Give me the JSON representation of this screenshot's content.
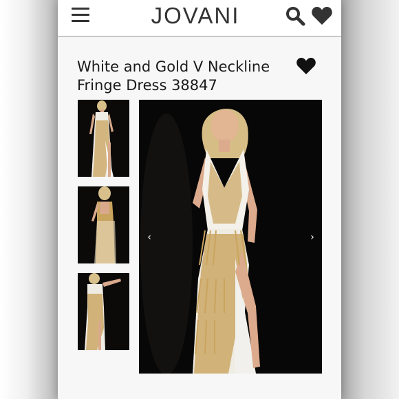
{
  "header": {
    "logo": "JOVANI",
    "icons": [
      "menu-icon",
      "search-icon",
      "heart-icon"
    ]
  },
  "product": {
    "title_line1": "White and Gold V Neckline",
    "title_line2": "Fringe Dress 38847"
  },
  "gallery": {
    "thumbnail_count": 3,
    "prev_glyph": "‹",
    "next_glyph": "›"
  },
  "colors": {
    "text": "#1a1a1a",
    "icon": "#333333",
    "photo_background": "#070707",
    "dress_white": "#f3f1ea",
    "dress_gold": "#c9a45e"
  }
}
